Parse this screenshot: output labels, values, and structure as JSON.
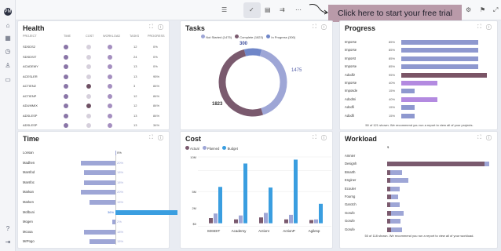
{
  "sidebar": {
    "icons": [
      "app-logo",
      "home-icon",
      "clock-icon",
      "calendar-icon",
      "user-icon",
      "folder-icon",
      "help-icon",
      "logout-icon"
    ]
  },
  "toolbar": {
    "tools": [
      "list-icon",
      "check-icon",
      "clipboard-icon",
      "flow-icon",
      "more-icon"
    ],
    "cta_label": "Click here to start your free trial",
    "right_icons": [
      "settings-icon",
      "notification-icon",
      "expand-icon"
    ]
  },
  "health": {
    "title": "Health",
    "headers": [
      "PROJECT",
      "TIME",
      "COST",
      "WORKLOAD",
      "TASKS",
      "PROGRESS"
    ],
    "rows": [
      {
        "name": "SDSDS2",
        "time": "#8a75a7",
        "cost": "#d6d0dc",
        "workload": "#a58fc0",
        "tasks": "12",
        "progress": "0%"
      },
      {
        "name": "SDSDSIT",
        "time": "#8a75a7",
        "cost": "#d6d0dc",
        "workload": "#a58fc0",
        "tasks": "24",
        "progress": "0%"
      },
      {
        "name": "ACADEMY",
        "time": "#8a75a7",
        "cost": "#d6d0dc",
        "workload": "#a58fc0",
        "tasks": "13",
        "progress": "0%"
      },
      {
        "name": "ACESLER",
        "time": "#8a75a7",
        "cost": "#d6d0dc",
        "workload": "#a58fc0",
        "tasks": "13",
        "progress": "95%"
      },
      {
        "name": "ACTIEN2",
        "time": "#8a75a7",
        "cost": "#6e5164",
        "workload": "#a58fc0",
        "tasks": "3",
        "progress": "84%"
      },
      {
        "name": "ACTIENP",
        "time": "#8a75a7",
        "cost": "#d6d0dc",
        "workload": "#a58fc0",
        "tasks": "12",
        "progress": "84%"
      },
      {
        "name": "ADUMMIX",
        "time": "#8a75a7",
        "cost": "#6e5164",
        "workload": "#a58fc0",
        "tasks": "12",
        "progress": "84%"
      },
      {
        "name": "ADSLESP",
        "time": "#8a75a7",
        "cost": "#d6d0dc",
        "workload": "#a58fc0",
        "tasks": "13",
        "progress": "84%"
      },
      {
        "name": "ADSLESP",
        "time": "#8a75a7",
        "cost": "#d6d0dc",
        "workload": "#a58fc0",
        "tasks": "13",
        "progress": "34%"
      }
    ]
  },
  "tasks": {
    "title": "Tasks",
    "legend": [
      "Not Started (1475)",
      "Complete (1823)",
      "In Progress (300)"
    ],
    "label_complete": "1823",
    "label_not_started": "1475",
    "label_in_progress": "300"
  },
  "progress": {
    "title": "Progress",
    "rows": [
      {
        "name": "Imporse",
        "pct": "85%",
        "value": 85,
        "color": "#8e98cf"
      },
      {
        "name": "Imporse",
        "pct": "85%",
        "value": 85,
        "color": "#8e98cf"
      },
      {
        "name": "Imporst",
        "pct": "85%",
        "value": 85,
        "color": "#8e98cf"
      },
      {
        "name": "Imporse",
        "pct": "85%",
        "value": 85,
        "color": "#8e98cf"
      },
      {
        "name": "Adodfz",
        "pct": "95%",
        "value": 95,
        "color": "#7a5466"
      },
      {
        "name": "Imporse",
        "pct": "40%",
        "value": 40,
        "color": "#b38ae0"
      },
      {
        "name": "Imposde",
        "pct": "15%",
        "value": 15,
        "color": "#8e98cf"
      },
      {
        "name": "Adodmi",
        "pct": "40%",
        "value": 40,
        "color": "#b38ae0"
      },
      {
        "name": "Adodfi",
        "pct": "15%",
        "value": 15,
        "color": "#8e98cf"
      },
      {
        "name": "Adodfi",
        "pct": "15%",
        "value": 15,
        "color": "#8e98cf"
      }
    ],
    "footer": "50 of 121 shown. We recommend you run a report to view all of your projects."
  },
  "time": {
    "title": "Time",
    "rows": [
      {
        "name": "Lonsan",
        "pct": "0%"
      },
      {
        "name": "Madhen",
        "pct": "20%"
      },
      {
        "name": "Marsfod",
        "pct": "18%"
      },
      {
        "name": "Marsfoc",
        "pct": "18%"
      },
      {
        "name": "Markan",
        "pct": "20%"
      },
      {
        "name": "Marken",
        "pct": "15%"
      },
      {
        "name": "Mofbuni",
        "pct": "36%"
      },
      {
        "name": "Mogen",
        "pct": "2%"
      },
      {
        "name": "Mcooa",
        "pct": "18%"
      },
      {
        "name": "MrPogo",
        "pct": "15%"
      }
    ]
  },
  "cost": {
    "title": "Cost",
    "legend": [
      "Actual",
      "Planned",
      "Budget"
    ],
    "yticks": [
      "10M",
      "5M",
      "2M",
      "$0"
    ],
    "categories": [
      "SDSDIT",
      "Academy",
      "ActionI",
      "ActionP",
      "Agilesp"
    ]
  },
  "workload": {
    "title": "Workload",
    "header_value": "$",
    "rows": [
      {
        "name": "Amnier",
        "a": 0,
        "b": 0
      },
      {
        "name": "Designh",
        "a": 95,
        "b": 5
      },
      {
        "name": "Bmarth",
        "a": 3,
        "b": 12
      },
      {
        "name": "Enginer",
        "a": 3,
        "b": 18
      },
      {
        "name": "Ecouler",
        "a": 3,
        "b": 9
      },
      {
        "name": "Fourng",
        "a": 4,
        "b": 7
      },
      {
        "name": "Garctch",
        "a": 3,
        "b": 9
      },
      {
        "name": "Gorufe",
        "a": 4,
        "b": 12
      },
      {
        "name": "Gorufe",
        "a": 3,
        "b": 10
      },
      {
        "name": "Gorufe",
        "a": 4,
        "b": 11
      }
    ],
    "footer": "50 of 118 shown. We recommend you run a report to view all of your workload."
  },
  "chart_data": [
    {
      "type": "pie",
      "title": "Tasks",
      "categories": [
        "Not Started",
        "Complete",
        "In Progress"
      ],
      "values": [
        1475,
        1823,
        300
      ],
      "colors": [
        "#9ea6d6",
        "#7a5a6e",
        "#6f86c8"
      ]
    },
    {
      "type": "bar",
      "title": "Time",
      "categories": [
        "Lonsan",
        "Madhen",
        "Marsfod",
        "Marsfoc",
        "Markan",
        "Marken",
        "Mofbuni",
        "Mogen",
        "Mcooa",
        "MrPogo"
      ],
      "values": [
        0,
        20,
        18,
        18,
        20,
        15,
        36,
        2,
        18,
        15
      ]
    },
    {
      "type": "bar",
      "title": "Cost",
      "categories": [
        "SDSDIT",
        "Academy",
        "ActionI",
        "ActionP",
        "Agilesp"
      ],
      "series": [
        {
          "name": "Actual",
          "values": [
            0.8,
            0.6,
            0.9,
            0.6,
            0.5
          ],
          "color": "#7a5a6e"
        },
        {
          "name": "Planned",
          "values": [
            1.5,
            1.2,
            1.6,
            1.3,
            0.6
          ],
          "color": "#9ea6d6"
        },
        {
          "name": "Budget",
          "values": [
            5.6,
            9.2,
            5.5,
            9.8,
            3.0
          ],
          "color": "#3a9ee0"
        }
      ],
      "ylim": [
        0,
        10
      ]
    }
  ]
}
